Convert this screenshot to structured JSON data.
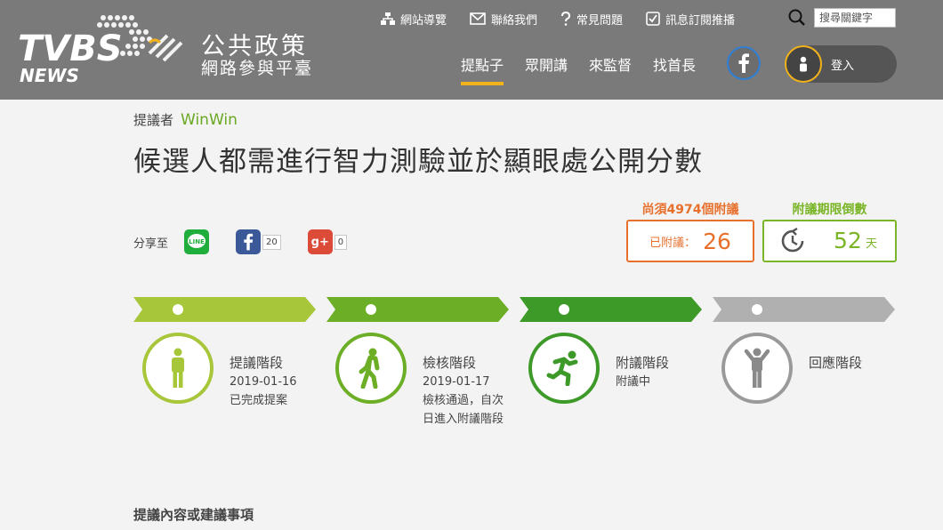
{
  "header": {
    "logo_text": "TVBS NEWS",
    "brand_title": "公共政策",
    "brand_subtitle": "網路參與平臺",
    "top_links": [
      {
        "label": "網站導覽",
        "icon": "sitemap-icon"
      },
      {
        "label": "聯絡我們",
        "icon": "mail-icon"
      },
      {
        "label": "常見問題",
        "icon": "question-icon"
      },
      {
        "label": "訊息訂閱推播",
        "icon": "checkbox-icon"
      }
    ],
    "search": {
      "placeholder": "搜尋關鍵字"
    },
    "nav": [
      {
        "label": "提點子",
        "active": true
      },
      {
        "label": "眾開講",
        "active": false
      },
      {
        "label": "來監督",
        "active": false
      },
      {
        "label": "找首長",
        "active": false
      }
    ],
    "login_label": "登入"
  },
  "proposal": {
    "proposer_label": "提議者",
    "proposer_name": "WinWin",
    "title": "候選人都需進行智力測驗並於顯眼處公開分數"
  },
  "share": {
    "label": "分享至",
    "facebook_count": "20",
    "google_count": "0"
  },
  "endorse": {
    "needed": "尚須4974個附議",
    "current_label": "已附議：",
    "current_value": "26"
  },
  "countdown": {
    "label": "附議期限倒數",
    "value": "52",
    "unit": "天"
  },
  "stages": [
    {
      "name": "提議階段",
      "lines": [
        "2019-01-16",
        "已完成提案"
      ],
      "color": "#a8c63a",
      "icon": "standing-person-icon"
    },
    {
      "name": "檢核階段",
      "lines": [
        "2019-01-17",
        "檢核通過，自次",
        "日進入附議階段"
      ],
      "color": "#6cae25",
      "icon": "walking-person-icon"
    },
    {
      "name": "附議階段",
      "lines": [
        "附議中"
      ],
      "color": "#3e9a28",
      "icon": "running-person-icon"
    },
    {
      "name": "回應階段",
      "lines": [],
      "color": "#9a9a9a",
      "icon": "arms-up-person-icon"
    }
  ],
  "content_section_title": "提議內容或建議事項",
  "colors": {
    "header_bg": "#7a7a7a",
    "accent_yellow": "#f2b21b",
    "orange": "#e8702d",
    "green": "#7ab527"
  }
}
